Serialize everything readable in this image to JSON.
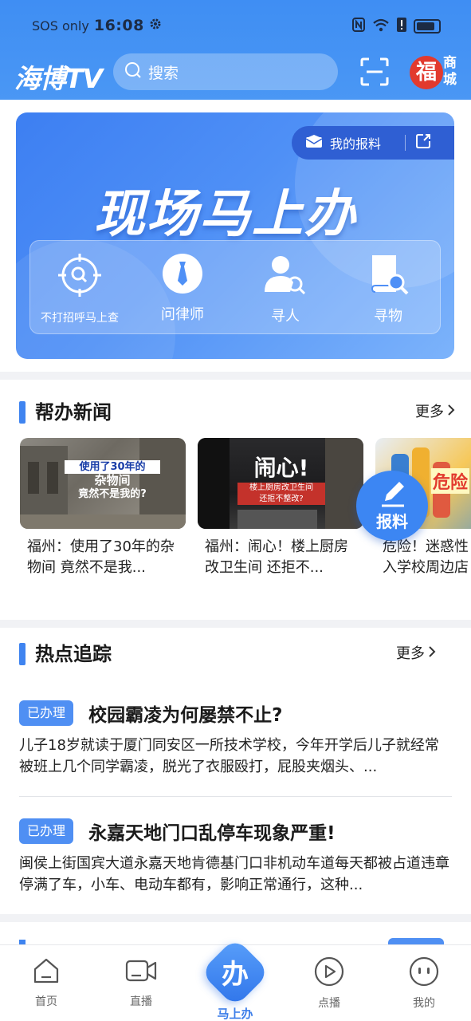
{
  "status_bar": {
    "carrier": "SOS only",
    "time": "16:08"
  },
  "header": {
    "logo": "海博TV",
    "search_placeholder": "搜索",
    "mall_label": "商城",
    "mall_badge": "福"
  },
  "banner": {
    "report_label": "我的报料",
    "title": "现场马上办",
    "actions": [
      {
        "label": "不打招呼马上查",
        "icon": "magnifier-target-icon"
      },
      {
        "label": "问律师",
        "icon": "tie-icon"
      },
      {
        "label": "寻人",
        "icon": "person-search-icon"
      },
      {
        "label": "寻物",
        "icon": "book-search-icon"
      }
    ]
  },
  "help_news": {
    "title": "帮办新闻",
    "more": "更多",
    "items": [
      {
        "thumb_text_line1": "使用了30年的",
        "thumb_text_line2": "杂物间",
        "thumb_text_line3": "竟然不是我的?",
        "caption": "福州：使用了30年的杂物间 竟然不是我..."
      },
      {
        "thumb_text_line1": "闹心!",
        "thumb_text_line2": "楼上厨房改卫生间",
        "thumb_text_line3": "还拒不整改?",
        "caption": "福州：闹心！楼上厨房改卫生间 还拒不..."
      },
      {
        "thumb_text_line1": "危险",
        "thumb_text_line2": "",
        "thumb_text_line3": "",
        "caption": "危险！迷惑性入学校周边店"
      }
    ],
    "fab_label": "报料"
  },
  "hot_tracking": {
    "title": "热点追踪",
    "more": "更多",
    "items": [
      {
        "badge": "已办理",
        "title": "校园霸凌为何屡禁不止?",
        "desc": "儿子18岁就读于厦门同安区一所技术学校，今年开学后儿子就经常被班上几个同学霸凌，脱光了衣服殴打，屁股夹烟头、..."
      },
      {
        "badge": "已办理",
        "title": "永嘉天地门口乱停车现象严重!",
        "desc": "闽侯上街国宾大道永嘉天地肯德基门口非机动车道每天都被占道违章停满了车，小车、电动车都有，影响正常通行，这种..."
      }
    ]
  },
  "bottom_nav": {
    "items": [
      {
        "label": "首页"
      },
      {
        "label": "直播"
      },
      {
        "label": "马上办",
        "glyph": "办"
      },
      {
        "label": "点播"
      },
      {
        "label": "我的"
      }
    ]
  },
  "colors": {
    "primary": "#3f8ef3",
    "accent": "#3b7de9",
    "badge": "#4f8ff3"
  }
}
